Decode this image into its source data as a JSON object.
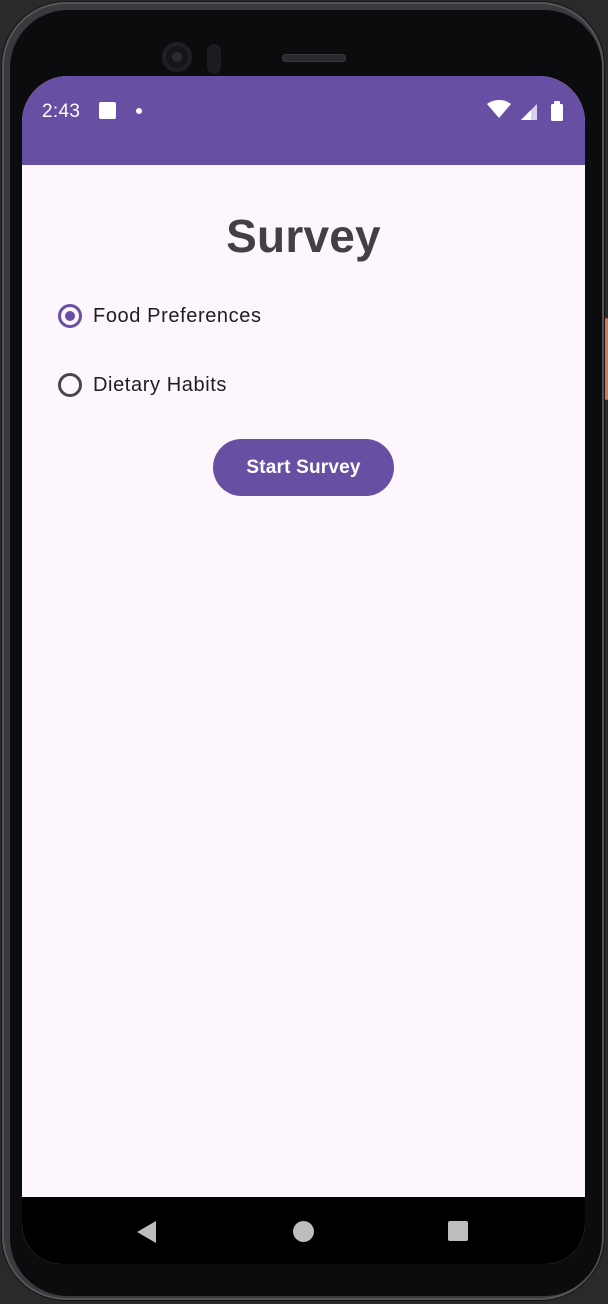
{
  "status_bar": {
    "time": "2:43",
    "background_color": "#6750a4",
    "icons": [
      "notification-square-icon",
      "notification-dot-icon",
      "wifi-icon",
      "signal-icon",
      "battery-icon"
    ]
  },
  "survey": {
    "title": "Survey",
    "options": [
      {
        "label": "Food Preferences",
        "selected": true
      },
      {
        "label": "Dietary Habits",
        "selected": false
      }
    ],
    "start_button_label": "Start Survey"
  },
  "colors": {
    "accent": "#6750a4",
    "background": "#fdf6fd",
    "title_text": "#433f47"
  },
  "nav_bar": {
    "icons": [
      "back-icon",
      "home-icon",
      "recents-icon"
    ]
  }
}
